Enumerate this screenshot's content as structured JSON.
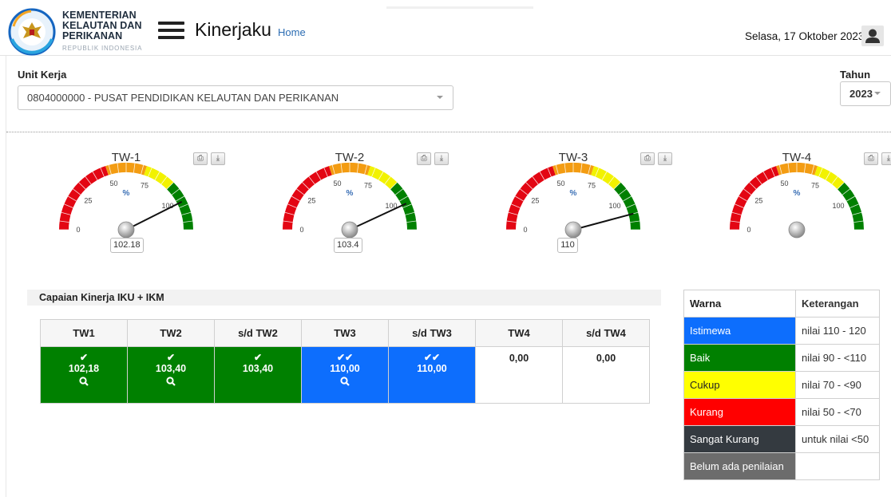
{
  "header": {
    "org_line1": "KEMENTERIAN",
    "org_line2": "KELAUTAN DAN",
    "org_line3": "PERIKANAN",
    "org_sub": "REPUBLIK INDONESIA",
    "app_title": "Kinerjaku",
    "home_link": "Home",
    "date": "Selasa, 17 Oktober 2023"
  },
  "filters": {
    "unit_label": "Unit Kerja",
    "unit_value": "0804000000 - PUSAT PENDIDIKAN KELAUTAN DAN PERIKANAN",
    "year_label": "Tahun",
    "year_value": "2023"
  },
  "gauges": [
    {
      "title": "TW-1",
      "value": 102.18,
      "value_label": "102.18"
    },
    {
      "title": "TW-2",
      "value": 103.4,
      "value_label": "103.4"
    },
    {
      "title": "TW-3",
      "value": 110,
      "value_label": "110"
    },
    {
      "title": "TW-4",
      "value": null,
      "value_label": ""
    }
  ],
  "gauge_scale": {
    "ticks": [
      "0",
      "25",
      "50",
      "75",
      "100"
    ],
    "unit": "%",
    "max": 120
  },
  "capaian": {
    "title": "Capaian Kinerja IKU + IKM",
    "headers": [
      "TW1",
      "TW2",
      "s/d TW2",
      "TW3",
      "s/d TW3",
      "TW4",
      "s/d TW4"
    ],
    "cells": [
      {
        "value": "102,18",
        "thumbs": 1,
        "search": true,
        "color": "#008000"
      },
      {
        "value": "103,40",
        "thumbs": 1,
        "search": true,
        "color": "#008000"
      },
      {
        "value": "103,40",
        "thumbs": 1,
        "search": false,
        "color": "#008000"
      },
      {
        "value": "110,00",
        "thumbs": 2,
        "search": true,
        "color": "#0d6efd"
      },
      {
        "value": "110,00",
        "thumbs": 2,
        "search": false,
        "color": "#0d6efd"
      },
      {
        "value": "0,00",
        "thumbs": 0,
        "search": false,
        "color": "#ffffff"
      },
      {
        "value": "0,00",
        "thumbs": 0,
        "search": false,
        "color": "#ffffff"
      }
    ]
  },
  "legend": {
    "col_warna": "Warna",
    "col_ket": "Keterangan",
    "rows": [
      {
        "label": "Istimewa",
        "desc": "nilai 110 - 120",
        "bg": "#0d6efd",
        "fg": "#ffffff"
      },
      {
        "label": "Baik",
        "desc": "nilai 90 - <110",
        "bg": "#008000",
        "fg": "#ffffff"
      },
      {
        "label": "Cukup",
        "desc": "nilai 70 - <90",
        "bg": "#ffff00",
        "fg": "#222222"
      },
      {
        "label": "Kurang",
        "desc": "nilai 50 - <70",
        "bg": "#ff0000",
        "fg": "#ffffff"
      },
      {
        "label": "Sangat Kurang",
        "desc": "untuk nilai <50",
        "bg": "#343a40",
        "fg": "#ffffff"
      },
      {
        "label": "Belum ada penilaian",
        "desc": "",
        "bg": "#6c6c6c",
        "fg": "#ffffff"
      }
    ]
  },
  "colors": {
    "red": "#e30613",
    "orange": "#f39c12",
    "yellow": "#f2f200",
    "green": "#008000"
  }
}
